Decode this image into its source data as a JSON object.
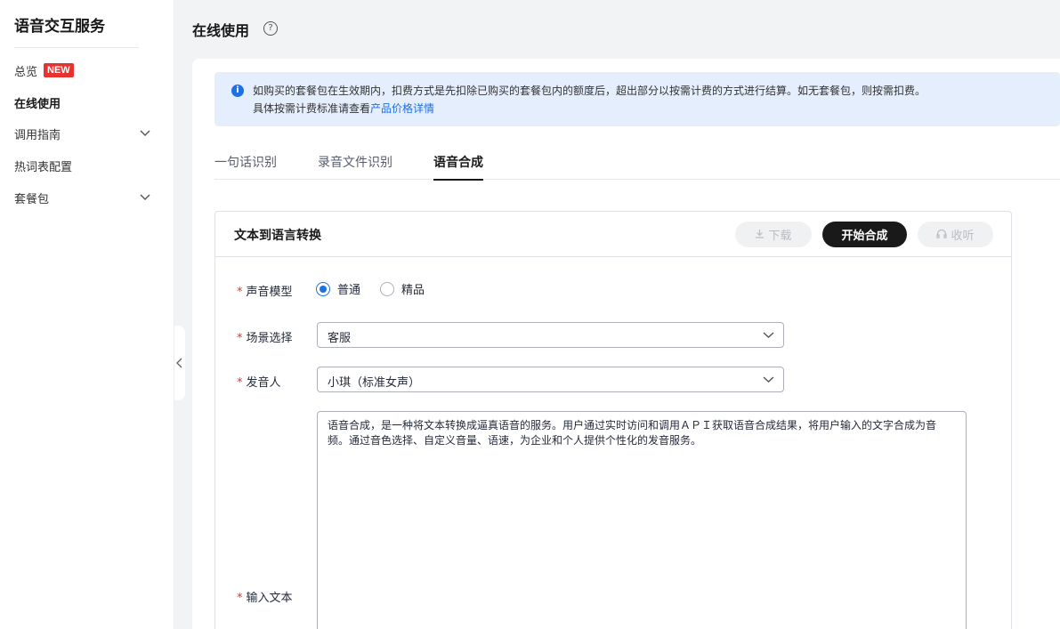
{
  "sidebar": {
    "title": "语音交互服务",
    "items": [
      {
        "label": "总览",
        "badge": "NEW"
      },
      {
        "label": "在线使用"
      },
      {
        "label": "调用指南"
      },
      {
        "label": "热词表配置"
      },
      {
        "label": "套餐包"
      }
    ]
  },
  "header": {
    "title": "在线使用",
    "help_icon": "?"
  },
  "notice": {
    "icon": "i",
    "line1": "如购买的套餐包在生效期内，扣费方式是先扣除已购买的套餐包内的额度后，超出部分以按需计费的方式进行结算。如无套餐包，则按需扣费。",
    "line2_prefix": "具体按需计费标准请查看",
    "line2_link": "产品价格详情"
  },
  "tabs": [
    {
      "label": "一句话识别"
    },
    {
      "label": "录音文件识别"
    },
    {
      "label": "语音合成"
    }
  ],
  "panel": {
    "title": "文本到语言转换",
    "download_label": "下载",
    "start_label": "开始合成",
    "listen_label": "收听"
  },
  "form": {
    "required_mark": "*",
    "model_label": "声音模型",
    "model_options": [
      "普通",
      "精品"
    ],
    "scene_label": "场景选择",
    "scene_value": "客服",
    "speaker_label": "发音人",
    "speaker_value": "小琪（标准女声）",
    "input_label": "输入文本",
    "input_value": "语音合成，是一种将文本转换成逼真语音的服务。用户通过实时访问和调用ＡＰＩ获取语音合成结果，将用户输入的文字合成为音频。通过音色选择、自定义音量、语速，为企业和个人提供个性化的发音服务。"
  }
}
